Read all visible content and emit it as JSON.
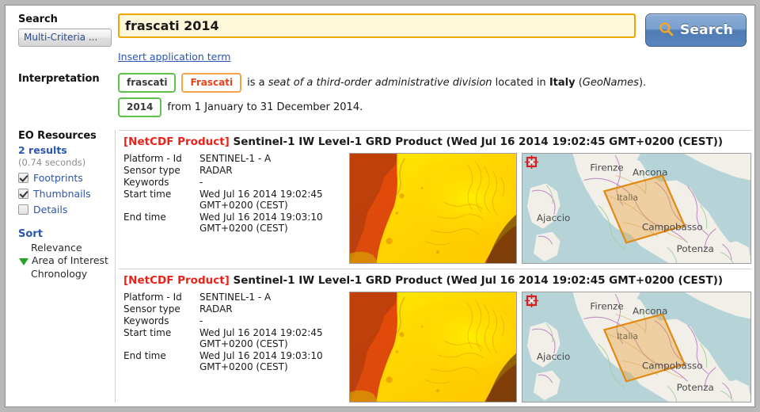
{
  "search": {
    "label": "Search",
    "multi_criteria_label": "Multi-Criteria ...",
    "input_value": "frascati 2014",
    "input_placeholder": "",
    "button_label": "Search",
    "button_icon": "search-icon",
    "insert_link_label": "Insert application term"
  },
  "interpretation": {
    "label": "Interpretation",
    "line1": {
      "chip_green": "frascati",
      "chip_orange": "Frascati",
      "text_1": "is a ",
      "text_italic": "seat of a third-order administrative division",
      "text_2": " located in ",
      "text_bold": "Italy",
      "text_3": " (",
      "text_italic2": "GeoNames",
      "text_4": ")."
    },
    "line2": {
      "chip_green": "2014",
      "text": "from 1 January to 31 December 2014."
    }
  },
  "sidebar": {
    "eo_resources_label": "EO Resources",
    "results_count": "2 results",
    "results_time": "(0.74 seconds)",
    "checkboxes": [
      {
        "label": "Footprints",
        "checked": true
      },
      {
        "label": "Thumbnails",
        "checked": true
      },
      {
        "label": "Details",
        "checked": false
      }
    ],
    "sort_label": "Sort",
    "sort_options": [
      {
        "label": "Relevance",
        "active": false
      },
      {
        "label": "Area of Interest",
        "active": true
      },
      {
        "label": "Chronology",
        "active": false
      }
    ]
  },
  "results": [
    {
      "product_tag": "[NetCDF Product]",
      "title": "Sentinel-1 IW Level-1 GRD Product (Wed Jul 16 2014 19:02:45 GMT+0200 (CEST))",
      "fields": [
        {
          "key": "Platform - Id",
          "value": "SENTINEL-1 - A"
        },
        {
          "key": "Sensor type",
          "value": "RADAR"
        },
        {
          "key": "Keywords",
          "value": "-"
        },
        {
          "key": "Start time",
          "value": "Wed Jul 16 2014 19:02:45\nGMT+0200 (CEST)"
        },
        {
          "key": "End time",
          "value": "Wed Jul 16 2014 19:03:10\nGMT+0200 (CEST)"
        }
      ],
      "map_labels": [
        "Firenze",
        "Ancona",
        "Ajaccio",
        "Italia",
        "Campobasso",
        "Potenza"
      ]
    },
    {
      "product_tag": "[NetCDF Product]",
      "title": "Sentinel-1 IW Level-1 GRD Product (Wed Jul 16 2014 19:02:45 GMT+0200 (CEST))",
      "fields": [
        {
          "key": "Platform - Id",
          "value": "SENTINEL-1 - A"
        },
        {
          "key": "Sensor type",
          "value": "RADAR"
        },
        {
          "key": "Keywords",
          "value": "-"
        },
        {
          "key": "Start time",
          "value": "Wed Jul 16 2014 19:02:45\nGMT+0200 (CEST)"
        },
        {
          "key": "End time",
          "value": "Wed Jul 16 2014 19:03:10\nGMT+0200 (CEST)"
        }
      ],
      "map_labels": [
        "Firenze",
        "Ancona",
        "Ajaccio",
        "Italia",
        "Campobasso",
        "Potenza"
      ]
    }
  ],
  "colors": {
    "accent_blue": "#2b56b0",
    "netcdf_red": "#e8231a",
    "chip_green": "#5fc34b",
    "chip_orange": "#f4a34a",
    "input_border": "#f0a500",
    "footprint": "#e8a33d"
  }
}
